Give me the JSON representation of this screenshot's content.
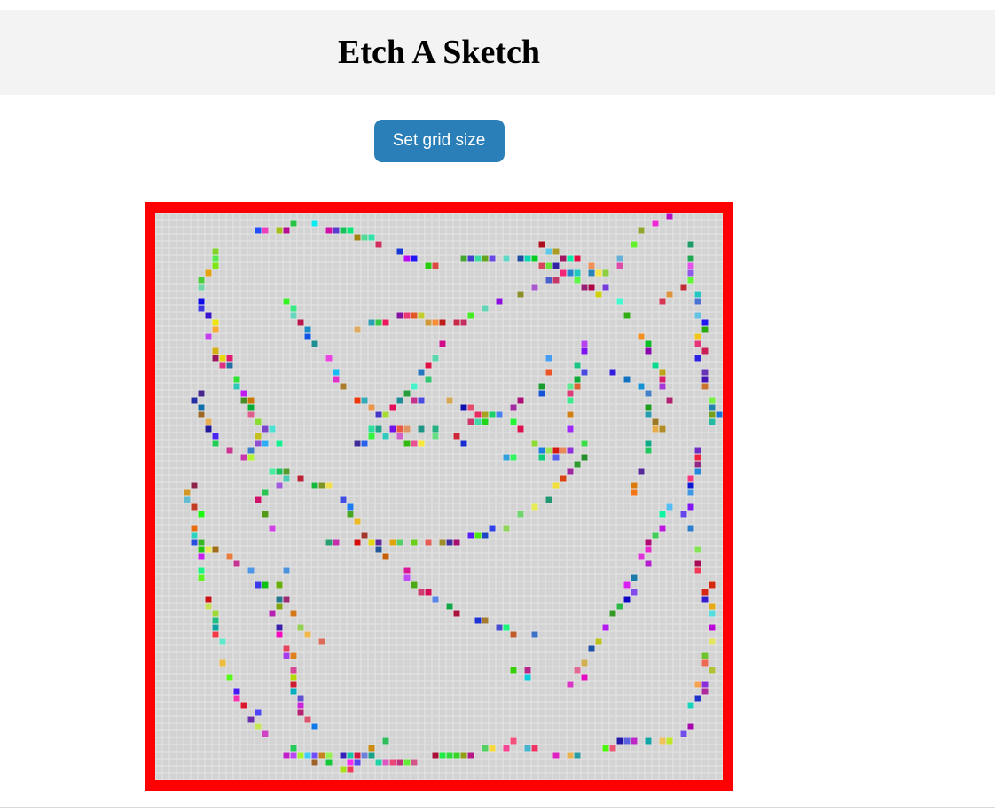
{
  "header": {
    "title": "Etch A Sketch"
  },
  "controls": {
    "set_grid_label": "Set grid size"
  },
  "grid": {
    "size": 80,
    "default_color": "#d3d3d3",
    "border_color": "#ff0000"
  },
  "colors": {
    "header_bg": "#f3f3f3",
    "button_bg": "#2b7fb8",
    "button_text": "#ffffff"
  }
}
